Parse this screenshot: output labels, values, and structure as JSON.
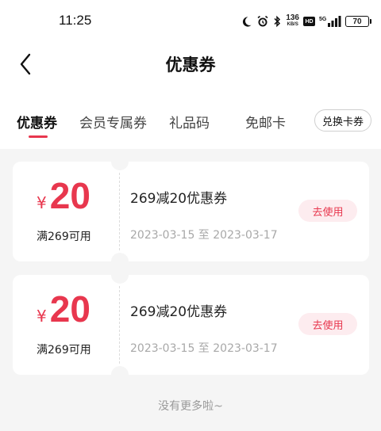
{
  "status_bar": {
    "time": "11:25",
    "net_speed_value": "136",
    "net_speed_unit": "KB/S",
    "hd_label": "HD",
    "signal_label": "5G",
    "battery": "70"
  },
  "header": {
    "title": "优惠券"
  },
  "tabs": [
    {
      "label": "优惠券",
      "active": true
    },
    {
      "label": "会员专属券"
    },
    {
      "label": "礼品码"
    },
    {
      "label": "免邮卡"
    }
  ],
  "redeem_button": "兑换卡券",
  "coupons": [
    {
      "currency": "¥",
      "amount": "20",
      "condition": "满269可用",
      "title": "269减20优惠券",
      "date_range": "2023-03-15 至 2023-03-17",
      "action": "去使用"
    },
    {
      "currency": "¥",
      "amount": "20",
      "condition": "满269可用",
      "title": "269减20优惠券",
      "date_range": "2023-03-15 至 2023-03-17",
      "action": "去使用"
    }
  ],
  "footer": "没有更多啦~",
  "colors": {
    "accent": "#e8374e",
    "button_bg": "#fdecef",
    "page_bg": "#f5f5f5"
  }
}
